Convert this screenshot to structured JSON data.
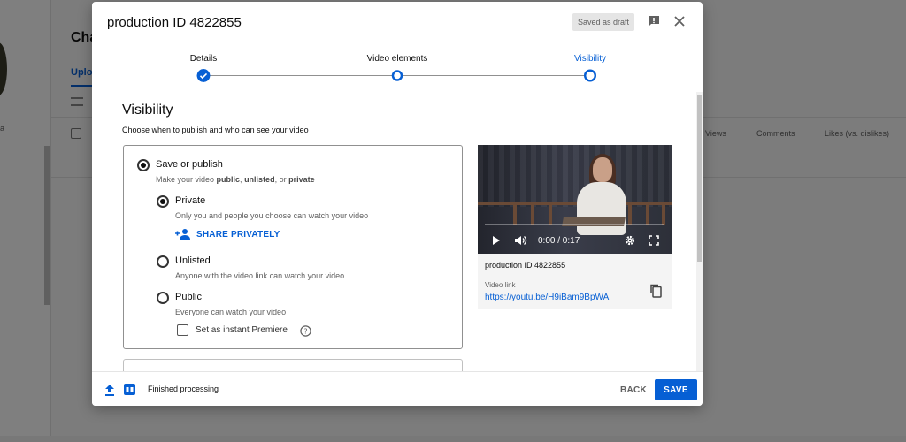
{
  "background": {
    "page_title": "Cha",
    "tab": "Uploa",
    "side_label": "a",
    "columns": [
      "Views",
      "Comments",
      "Likes (vs. dislikes)"
    ]
  },
  "dialog": {
    "title": "production ID 4822855",
    "draft_badge": "Saved as draft",
    "icons": {
      "feedback": "feedback-icon",
      "close": "close-icon"
    }
  },
  "stepper": {
    "steps": [
      {
        "label": "Details",
        "state": "complete"
      },
      {
        "label": "Video elements",
        "state": "complete"
      },
      {
        "label": "Visibility",
        "state": "active"
      }
    ]
  },
  "visibility": {
    "title": "Visibility",
    "subtitle": "Choose when to publish and who can see your video",
    "save_or_publish": {
      "label": "Save or publish",
      "desc_prefix": "Make your video ",
      "desc_public": "public",
      "desc_sep1": ", ",
      "desc_unlisted": "unlisted",
      "desc_sep2": ", or ",
      "desc_private": "private",
      "selected": true
    },
    "options": {
      "private": {
        "label": "Private",
        "desc": "Only you and people you choose can watch your video",
        "selected": true
      },
      "share_privately": "SHARE PRIVATELY",
      "unlisted": {
        "label": "Unlisted",
        "desc": "Anyone with the video link can watch your video",
        "selected": false
      },
      "public": {
        "label": "Public",
        "desc": "Everyone can watch your video",
        "selected": false
      },
      "premiere": {
        "label": "Set as instant Premiere",
        "checked": false
      }
    }
  },
  "preview": {
    "time": "0:00 / 0:17",
    "progress": 0,
    "title": "production ID 4822855",
    "link_label": "Video link",
    "link": "https://youtu.be/H9iBam9BpWA"
  },
  "footer": {
    "status": "Finished processing",
    "back": "BACK",
    "save": "SAVE"
  },
  "colors": {
    "accent": "#065fd4",
    "progress": "#ff0000"
  }
}
